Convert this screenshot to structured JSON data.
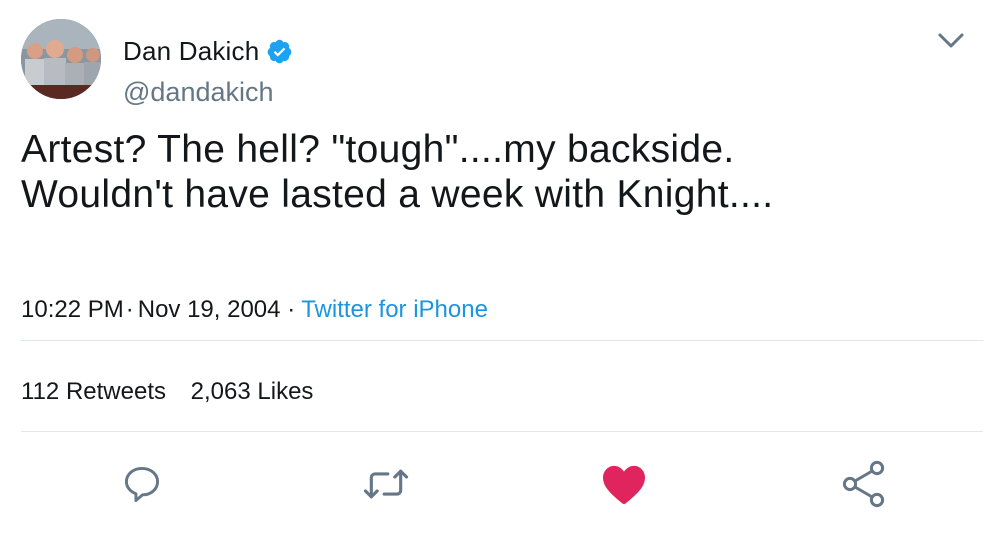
{
  "user": {
    "display_name": "Dan Dakich",
    "handle": "@dandakich",
    "verified": true,
    "avatar_icon": "profile-photo"
  },
  "tweet": {
    "text_line1": "Artest? The hell? \"tough\"....my backside.",
    "text_line2": "Wouldn't have lasted a week with Knight...."
  },
  "meta": {
    "time": "10:22 PM",
    "separator": "·",
    "date": "Nov 19, 2004",
    "source_separator": "·",
    "source": "Twitter for iPhone"
  },
  "stats": {
    "retweets_count": "112",
    "retweets_label": "Retweets",
    "likes_count": "2,063",
    "likes_label": "Likes"
  },
  "actions": {
    "reply_icon": "reply-icon",
    "retweet_icon": "retweet-icon",
    "like_icon": "heart-icon",
    "share_icon": "share-icon"
  },
  "colors": {
    "text": "#14171a",
    "secondary": "#657786",
    "link": "#1b95e0",
    "verified": "#1da1f2",
    "like": "#e0245e",
    "icon": "#657786",
    "divider": "#e1e8ed"
  }
}
